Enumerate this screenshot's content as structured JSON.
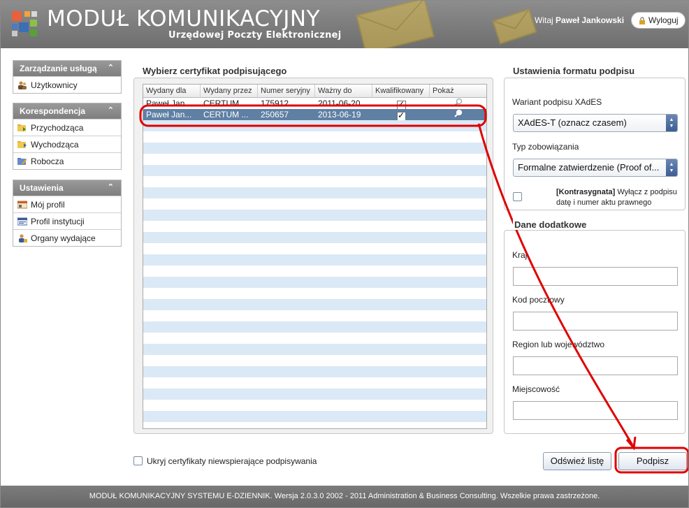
{
  "header": {
    "title": "MODUŁ KOMUNIKACYJNY",
    "subtitle": "Urzędowej Poczty Elektronicznej",
    "welcome_prefix": "Witaj",
    "user_name": "Paweł Jankowski",
    "logout_label": "Wyloguj"
  },
  "sidebar": {
    "groups": [
      {
        "title": "Zarządzanie usługą",
        "items": [
          {
            "label": "Użytkownicy",
            "icon": "users-icon"
          }
        ]
      },
      {
        "title": "Korespondencja",
        "items": [
          {
            "label": "Przychodząca",
            "icon": "inbox-folder-icon"
          },
          {
            "label": "Wychodząca",
            "icon": "outbox-folder-icon"
          },
          {
            "label": "Robocza",
            "icon": "drafts-folder-icon"
          }
        ]
      },
      {
        "title": "Ustawienia",
        "items": [
          {
            "label": "Mój profil",
            "icon": "profile-card-icon"
          },
          {
            "label": "Profil instytucji",
            "icon": "institution-card-icon"
          },
          {
            "label": "Organy wydające",
            "icon": "issuer-person-icon"
          }
        ]
      }
    ]
  },
  "certificates": {
    "title": "Wybierz certyfikat podpisującego",
    "columns": [
      "Wydany dla",
      "Wydany przez",
      "Numer seryjny",
      "Ważny do",
      "Kwalifikowany",
      "Pokaż"
    ],
    "rows": [
      {
        "issued_to": "Paweł Jan...",
        "issued_by": "CERTUM ...",
        "serial": "175912",
        "valid_to": "2011-06-20",
        "qualified": true,
        "selected": false
      },
      {
        "issued_to": "Paweł Jan...",
        "issued_by": "CERTUM ...",
        "serial": "250657",
        "valid_to": "2013-06-19",
        "qualified": true,
        "selected": true
      }
    ],
    "hide_unsupported_label": "Ukryj certyfikaty niewspierające podpisywania",
    "hide_unsupported_checked": false
  },
  "format": {
    "title": "Ustawienia formatu podpisu",
    "variant_label": "Wariant podpisu XAdES",
    "variant_value": "XAdES-T (oznacz czasem)",
    "commitment_label": "Typ zobowiązania",
    "commitment_value": "Formalne zatwierdzenie (Proof of...",
    "countersign_bold": "[Kontrasygnata]",
    "countersign_text": " Wyłącz z podpisu datę i numer aktu prawnego",
    "countersign_checked": false
  },
  "extra": {
    "title": "Dane dodatkowe",
    "fields": [
      {
        "label": "Kraj",
        "value": ""
      },
      {
        "label": "Kod pocztowy",
        "value": ""
      },
      {
        "label": "Region lub województwo",
        "value": ""
      },
      {
        "label": "Miejscowość",
        "value": ""
      }
    ]
  },
  "buttons": {
    "refresh": "Odśwież listę",
    "sign": "Podpisz"
  },
  "footer": "MODUŁ KOMUNIKACYJNY SYSTEMU E-DZIENNIK. Wersja 2.0.3.0 2002 - 2011 Administration & Business Consulting. Wszelkie prawa zastrzeżone.",
  "colors": {
    "header": "#7a7a7a",
    "selected_row": "#5f7fa3",
    "stripe": "#dbe9f6",
    "annotation": "#e00000"
  }
}
